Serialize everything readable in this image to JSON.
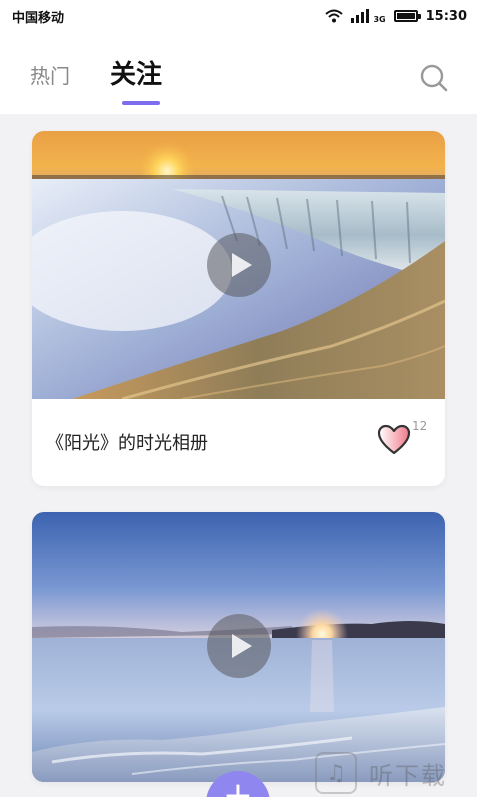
{
  "status_bar": {
    "carrier": "中国移动",
    "network": "3G",
    "time": "15:30"
  },
  "header": {
    "tabs": [
      {
        "label": "热门",
        "active": false
      },
      {
        "label": "关注",
        "active": true
      }
    ],
    "search_icon": "search-icon",
    "accent_color": "#7b6cf0"
  },
  "feed": {
    "cards": [
      {
        "title": "《阳光》的时光相册",
        "likes": "12",
        "image": "waterfall-sunset",
        "play_icon": "play-icon"
      },
      {
        "image": "seascape-sunset",
        "play_icon": "play-icon"
      }
    ]
  },
  "fab": {
    "label": "+",
    "color": "#8f86ef"
  },
  "watermark": {
    "text": "听下载"
  }
}
